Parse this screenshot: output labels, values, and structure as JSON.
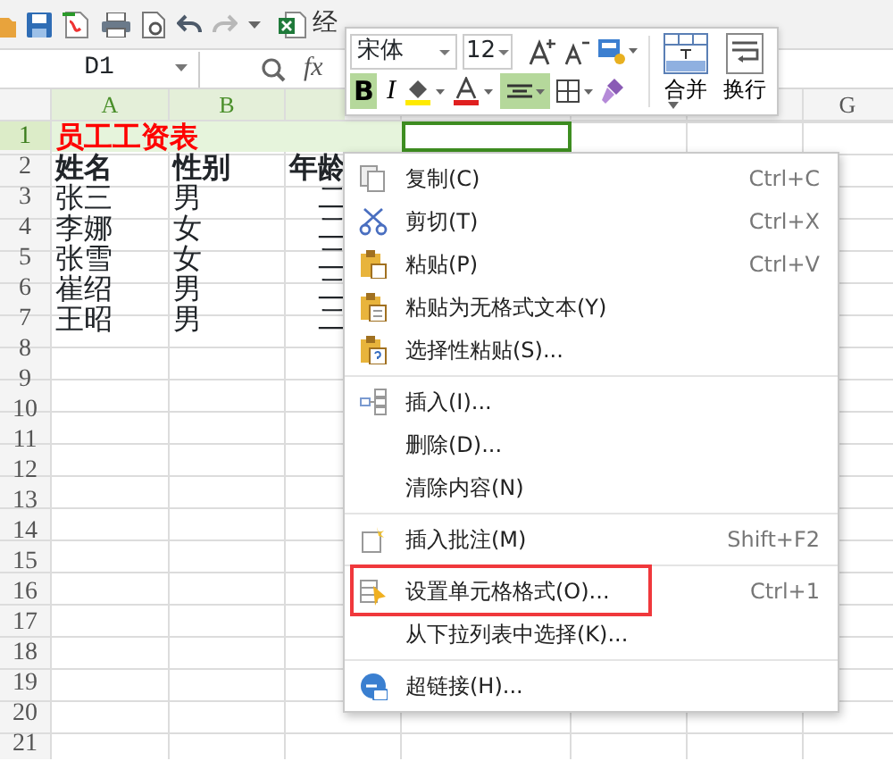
{
  "toolbar": {
    "doc_title": "经"
  },
  "formula_bar": {
    "cell_ref": "D1",
    "fx": "fx"
  },
  "sheet": {
    "columns": [
      {
        "label": "A",
        "selected": true
      },
      {
        "label": "B",
        "selected": true
      },
      {
        "selected": true
      },
      {},
      {},
      {},
      {
        "label": "G",
        "selected": false
      }
    ],
    "rows": [
      {
        "number": "1",
        "selected": true,
        "cells": [
          {
            "text": "员工工资表",
            "kind": "merged-title",
            "selected": true,
            "active": false
          },
          {
            "selected": false,
            "active": true
          }
        ]
      },
      {
        "number": "2",
        "selected": false,
        "cells": [
          {
            "text": "姓名",
            "kind": "header"
          },
          {
            "text": "性别",
            "kind": "header"
          },
          {
            "text": "年龄",
            "kind": "header"
          }
        ]
      },
      {
        "number": "3",
        "selected": false,
        "cells": [
          {
            "text": "张三"
          },
          {
            "text": "男"
          },
          {
            "text": "二",
            "kind": "clipped"
          }
        ]
      },
      {
        "number": "4",
        "selected": false,
        "cells": [
          {
            "text": "李娜"
          },
          {
            "text": "女"
          },
          {
            "text": "二",
            "kind": "clipped"
          }
        ]
      },
      {
        "number": "5",
        "selected": false,
        "cells": [
          {
            "text": "张雪"
          },
          {
            "text": "女"
          },
          {
            "text": "二",
            "kind": "clipped"
          }
        ]
      },
      {
        "number": "6",
        "selected": false,
        "cells": [
          {
            "text": "崔绍"
          },
          {
            "text": "男"
          },
          {
            "text": "二",
            "kind": "clipped"
          }
        ]
      },
      {
        "number": "7",
        "selected": false,
        "cells": [
          {
            "text": "王昭"
          },
          {
            "text": "男"
          },
          {
            "text": "二",
            "kind": "clipped"
          }
        ]
      },
      {
        "number": "8",
        "selected": false,
        "cells": []
      },
      {
        "number": "9",
        "selected": false,
        "cells": []
      },
      {
        "number": "10",
        "selected": false,
        "cells": []
      },
      {
        "number": "11",
        "selected": false,
        "cells": []
      },
      {
        "number": "12",
        "selected": false,
        "cells": []
      },
      {
        "number": "13",
        "selected": false,
        "cells": []
      },
      {
        "number": "14",
        "selected": false,
        "cells": []
      },
      {
        "number": "15",
        "selected": false,
        "cells": []
      },
      {
        "number": "16",
        "selected": false,
        "cells": []
      },
      {
        "number": "17",
        "selected": false,
        "cells": []
      },
      {
        "number": "18",
        "selected": false,
        "cells": []
      },
      {
        "number": "19",
        "selected": false,
        "cells": []
      },
      {
        "number": "20",
        "selected": false,
        "cells": []
      },
      {
        "number": "21",
        "selected": false,
        "cells": []
      }
    ]
  },
  "mini_toolbar": {
    "font": "宋体",
    "size": "12",
    "bold_label": "B",
    "bold": true,
    "italic_label": "I",
    "italic": false,
    "align_active": true,
    "merge_label": "合并",
    "wrap_label": "换行"
  },
  "context_menu": [
    {
      "label": "复制(C)",
      "shortcut": "Ctrl+C",
      "separator_after": false,
      "marked": false
    },
    {
      "label": "剪切(T)",
      "shortcut": "Ctrl+X",
      "separator_after": false,
      "marked": false
    },
    {
      "label": "粘贴(P)",
      "shortcut": "Ctrl+V",
      "separator_after": false,
      "marked": false
    },
    {
      "label": "粘贴为无格式文本(Y)",
      "separator_after": false,
      "marked": false
    },
    {
      "label": "选择性粘贴(S)...",
      "separator_after": true,
      "marked": false
    },
    {
      "label": "插入(I)...",
      "separator_after": false,
      "marked": false
    },
    {
      "label": "删除(D)...",
      "separator_after": false,
      "marked": false
    },
    {
      "label": "清除内容(N)",
      "separator_after": true,
      "marked": false
    },
    {
      "label": "插入批注(M)",
      "shortcut": "Shift+F2",
      "separator_after": true,
      "marked": false
    },
    {
      "label": "设置单元格格式(O)...",
      "shortcut": "Ctrl+1",
      "separator_after": false,
      "marked": true
    },
    {
      "label": "从下拉列表中选择(K)...",
      "separator_after": true,
      "marked": false
    },
    {
      "label": "超链接(H)...",
      "separator_after": false,
      "marked": false
    }
  ]
}
